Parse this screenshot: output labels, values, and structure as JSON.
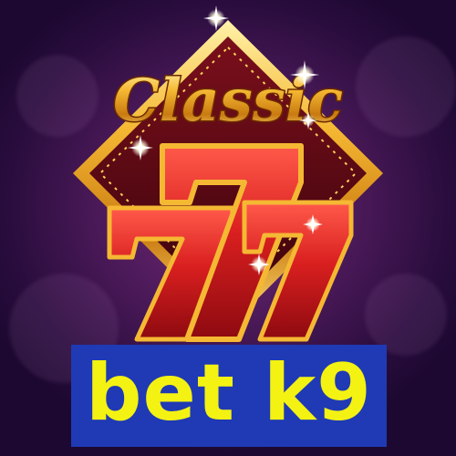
{
  "logo": {
    "wordmark": "Classic",
    "numerals": "77",
    "accent_colors": {
      "gold": "#f5b833",
      "red": "#c8161c",
      "dark_red": "#5a0a12",
      "background_purple": "#5a1f66"
    },
    "decoration": [
      "sparkle-icon",
      "marquee-lights"
    ]
  },
  "banner": {
    "text": "bet k9",
    "background_color": "#1f3ab4",
    "text_color": "#f3f213"
  }
}
